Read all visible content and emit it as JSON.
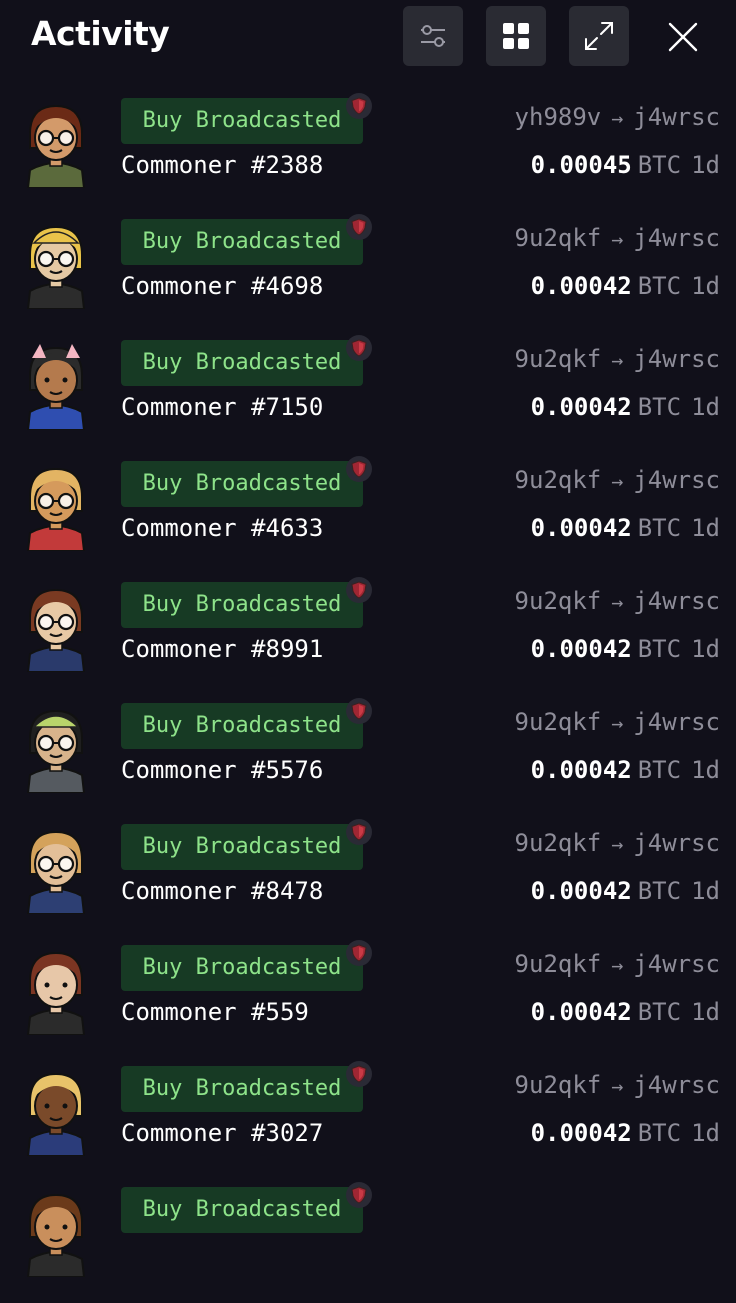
{
  "header": {
    "title": "Activity",
    "buttons": [
      {
        "name": "filter-button",
        "icon": "sliders-icon"
      },
      {
        "name": "grid-view-button",
        "icon": "grid-icon"
      },
      {
        "name": "expand-button",
        "icon": "expand-icon"
      }
    ],
    "close_icon": "close-icon"
  },
  "colors": {
    "background": "#11101a",
    "badge_bg": "#173a24",
    "badge_text": "#8ee38a",
    "muted_text": "#8e8d99",
    "shield": "#a02633"
  },
  "activity": [
    {
      "status": "Buy Broadcasted",
      "name": "Commoner #2388",
      "from": "yh989v",
      "arrow": "→",
      "to": "j4wrsc",
      "amount": "0.00045",
      "currency": "BTC",
      "age": "1d",
      "avatar": {
        "skin": "#d39a6a",
        "hair": "#6b2a16",
        "shirt": "#5b6a3c",
        "glasses": true,
        "hat": null
      }
    },
    {
      "status": "Buy Broadcasted",
      "name": "Commoner #4698",
      "from": "9u2qkf",
      "arrow": "→",
      "to": "j4wrsc",
      "amount": "0.00042",
      "currency": "BTC",
      "age": "1d",
      "avatar": {
        "skin": "#e5c9a3",
        "hair": "#e9c34a",
        "shirt": "#2c2c2c",
        "glasses": true,
        "hat": "#e9c34a"
      }
    },
    {
      "status": "Buy Broadcasted",
      "name": "Commoner #7150",
      "from": "9u2qkf",
      "arrow": "→",
      "to": "j4wrsc",
      "amount": "0.00042",
      "currency": "BTC",
      "age": "1d",
      "avatar": {
        "skin": "#b47a4d",
        "hair": "#2b2b2b",
        "shirt": "#2f4eb0",
        "glasses": false,
        "hat": "#f4b6c2"
      }
    },
    {
      "status": "Buy Broadcasted",
      "name": "Commoner #4633",
      "from": "9u2qkf",
      "arrow": "→",
      "to": "j4wrsc",
      "amount": "0.00042",
      "currency": "BTC",
      "age": "1d",
      "avatar": {
        "skin": "#d59a5c",
        "hair": "#e3b463",
        "shirt": "#c23a3a",
        "glasses": true,
        "hat": null
      }
    },
    {
      "status": "Buy Broadcasted",
      "name": "Commoner #8991",
      "from": "9u2qkf",
      "arrow": "→",
      "to": "j4wrsc",
      "amount": "0.00042",
      "currency": "BTC",
      "age": "1d",
      "avatar": {
        "skin": "#e8c9a5",
        "hair": "#7a3a22",
        "shirt": "#2a3a6b",
        "glasses": true,
        "hat": null
      }
    },
    {
      "status": "Buy Broadcasted",
      "name": "Commoner #5576",
      "from": "9u2qkf",
      "arrow": "→",
      "to": "j4wrsc",
      "amount": "0.00042",
      "currency": "BTC",
      "age": "1d",
      "avatar": {
        "skin": "#d8b38b",
        "hair": "#1f1f1f",
        "shirt": "#555a60",
        "glasses": true,
        "hat": "#b9d46b"
      }
    },
    {
      "status": "Buy Broadcasted",
      "name": "Commoner #8478",
      "from": "9u2qkf",
      "arrow": "→",
      "to": "j4wrsc",
      "amount": "0.00042",
      "currency": "BTC",
      "age": "1d",
      "avatar": {
        "skin": "#e3bf98",
        "hair": "#d4a25b",
        "shirt": "#2d3f73",
        "glasses": true,
        "hat": null
      }
    },
    {
      "status": "Buy Broadcasted",
      "name": "Commoner #559",
      "from": "9u2qkf",
      "arrow": "→",
      "to": "j4wrsc",
      "amount": "0.00042",
      "currency": "BTC",
      "age": "1d",
      "avatar": {
        "skin": "#e7c7a8",
        "hair": "#7b3522",
        "shirt": "#2b2b2b",
        "glasses": false,
        "hat": null
      }
    },
    {
      "status": "Buy Broadcasted",
      "name": "Commoner #3027",
      "from": "9u2qkf",
      "arrow": "→",
      "to": "j4wrsc",
      "amount": "0.00042",
      "currency": "BTC",
      "age": "1d",
      "avatar": {
        "skin": "#7a4a2a",
        "hair": "#e8c36a",
        "shirt": "#2b3c7a",
        "glasses": false,
        "hat": null
      }
    },
    {
      "status": "Buy Broadcasted",
      "name": "",
      "from": "",
      "arrow": "",
      "to": "",
      "amount": "",
      "currency": "",
      "age": "",
      "avatar": {
        "skin": "#c98f5c",
        "hair": "#6b3a1a",
        "shirt": "#2b2b2b",
        "glasses": false,
        "hat": null
      }
    }
  ]
}
